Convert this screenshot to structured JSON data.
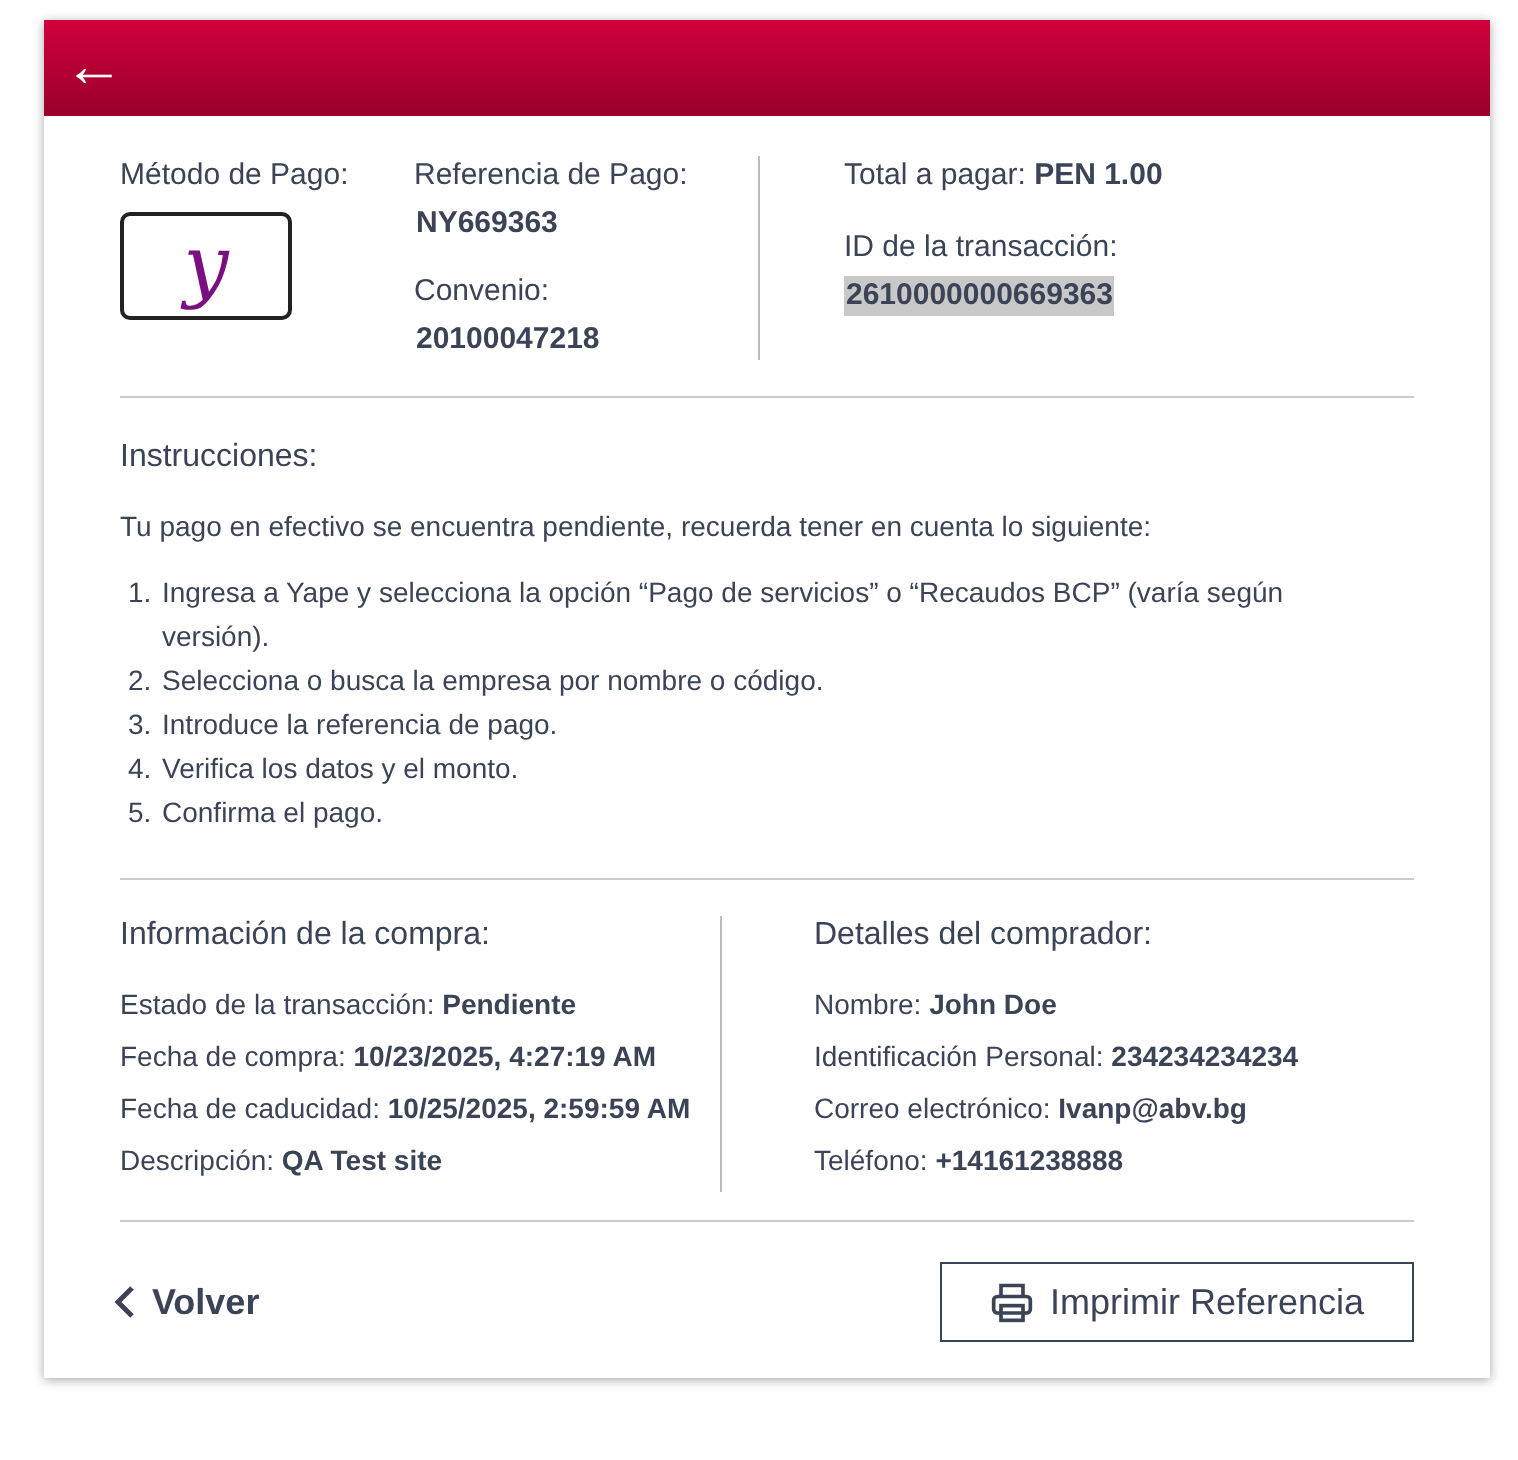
{
  "header": {
    "back": "←"
  },
  "payment": {
    "method_label": "Método de Pago:",
    "logo_text": "y",
    "reference_label": "Referencia de Pago:",
    "reference": "NY669363",
    "agreement_label": "Convenio:",
    "agreement": "20100047218",
    "total_label": "Total a pagar:",
    "total": "PEN 1.00",
    "transaction_label": "ID de la transacción:",
    "transaction_id": "2610000000669363",
    "transaction_id_selected": true
  },
  "instructions": {
    "title": "Instrucciones:",
    "intro": "Tu pago en efectivo se encuentra pendiente, recuerda tener en cuenta lo siguiente:",
    "steps": [
      {
        "number": "1.",
        "text": "Ingresa a Yape y selecciona la opción “Pago de servicios” o “Recaudos BCP” (varía según versión)."
      },
      {
        "number": "2.",
        "text": "Selecciona o busca la empresa por nombre o código."
      },
      {
        "number": "3.",
        "text": "Introduce la referencia de pago."
      },
      {
        "number": "4.",
        "text": "Verifica los datos y el monto."
      },
      {
        "number": "5.",
        "text": "Confirma el pago."
      }
    ]
  },
  "purchase_info": {
    "title": "Información de la compra:",
    "rows": [
      {
        "label": "Estado de la transacción:",
        "value": "Pendiente"
      },
      {
        "label": "Fecha de compra:",
        "value": "10/23/2025, 4:27:19 AM"
      },
      {
        "label": "Fecha de caducidad:",
        "value": "10/25/2025, 2:59:59 AM"
      },
      {
        "label": "Descripción:",
        "value": "QA Test site"
      }
    ]
  },
  "buyer_details": {
    "title": "Detalles del comprador:",
    "rows": [
      {
        "label": "Nombre:",
        "value": "John Doe"
      },
      {
        "label": "Identificación Personal:",
        "value": "234234234234"
      },
      {
        "label": "Correo electrónico:",
        "value": "Ivanp@abv.bg"
      },
      {
        "label": "Teléfono:",
        "value": "+14161238888"
      }
    ]
  },
  "footer": {
    "back": "Volver",
    "print": "Imprimir Referencia"
  }
}
